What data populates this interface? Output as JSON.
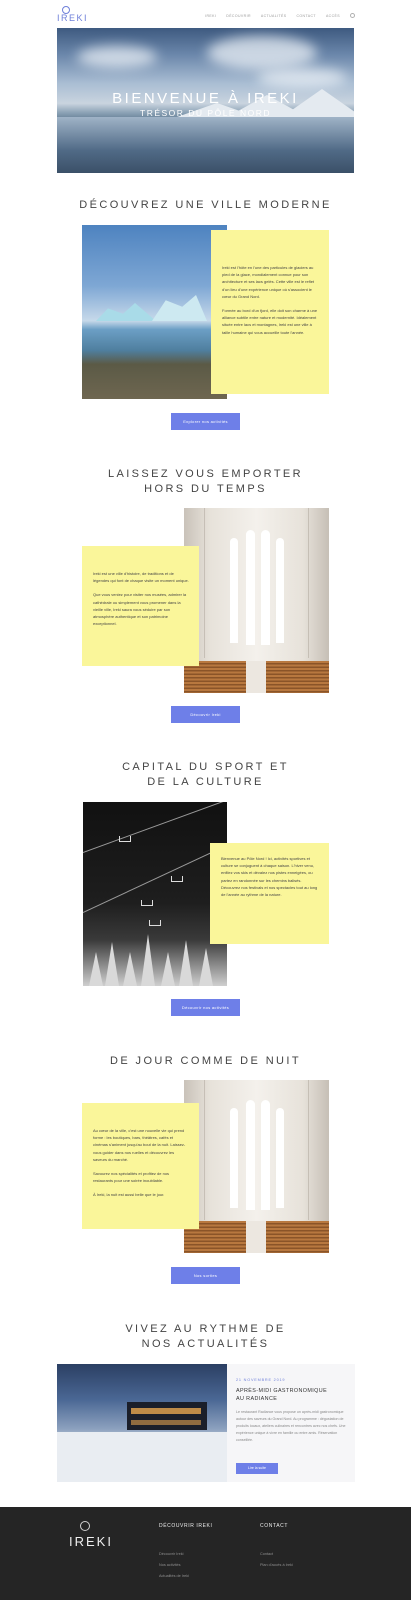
{
  "header": {
    "logo": "IREKI",
    "nav": [
      "IREKI",
      "DÉCOUVRIR",
      "ACTUALITÉS",
      "CONTACT",
      "ACCÈS"
    ]
  },
  "hero": {
    "title": "BIENVENUE À IREKI",
    "subtitle": "TRÉSOR DU PÔLE NORD"
  },
  "sections": [
    {
      "title_lines": [
        "DÉCOUVREZ UNE VILLE MODERNE"
      ],
      "paragraphs": [
        "Ireki est l'hôte en l'une des particules de glaciers au pied de la glace, mondialement connue pour son architecture et ses lacs gelés. Cette ville est le reflet d'un lieu d'une expérience unique où s'associent le cœur du Grand Nord.",
        "Formée au bord d'un fjord, elle doit son charme à une alliance subtile entre nature et modernité. Idéalement située entre lacs et montagnes, Ireki est une ville à taille humaine qui vous accueille toute l'année."
      ],
      "button": "Explorer nos activités"
    },
    {
      "title_lines": [
        "LAISSEZ VOUS EMPORTER",
        "HORS DU TEMPS"
      ],
      "paragraphs": [
        "Ireki est une ville d'histoire, de traditions et de légendes qui font de chaque visite un moment unique.",
        "Que vous veniez pour visiter nos musées, admirer la cathédrale ou simplement vous promener dans la vieille ville, Ireki saura vous séduire par son atmosphère authentique et son patrimoine exceptionnel."
      ],
      "button": "Découvrir Ireki"
    },
    {
      "title_lines": [
        "CAPITAL DU SPORT ET",
        "DE LA CULTURE"
      ],
      "paragraphs": [
        "Bienvenue au Pôle Nord ! Ici, activités sportives et culture se conjuguent à chaque saison. L'hiver venu, enfilez vos skis et dévalez nos pistes enneigées, ou partez en randonnée sur les chemins balisés. Découvrez nos festivals et nos spectacles tout au long de l'année au rythme de la nature."
      ],
      "button": "Découvrir nos activités"
    },
    {
      "title_lines": [
        "DE JOUR COMME DE NUIT"
      ],
      "paragraphs": [
        "Au cœur de la ville, c'est une nouvelle vie qui prend forme : les boutiques, bars, théâtres, cafés et cinémas s'animent jusqu'au bout de la nuit. Laissez-vous guider dans nos ruelles et découvrez les saveurs du marché.",
        "Savourez nos spécialités et profitez de nos restaurants pour une soirée inoubliable.",
        "À Ireki, la nuit est aussi belle que le jour."
      ],
      "button": "Nos sorties"
    }
  ],
  "news": {
    "title_lines": [
      "VIVEZ AU RYTHME DE",
      "NOS ACTUALITÉS"
    ],
    "date": "21 NOVEMBRE 2019",
    "headline_lines": [
      "APRÈS-MIDI GASTRONOMIQUE",
      "AU RADIANCE"
    ],
    "text": "Le restaurant Radiance vous propose un après-midi gastronomique autour des saveurs du Grand Nord. Au programme : dégustation de produits locaux, ateliers culinaires et rencontres avec nos chefs. Une expérience unique à vivre en famille ou entre amis. Réservation conseillée.",
    "button": "Lire la suite"
  },
  "footer": {
    "logo": "IREKI",
    "col1_title": "DÉCOUVRIR IREKI",
    "col1_links": [
      "Découvrir Ireki",
      "Nos activités",
      "Actualités de Ireki"
    ],
    "col2_title": "CONTACT",
    "col2_links": [
      "Contact",
      "Plan d'accès à Ireki"
    ]
  }
}
